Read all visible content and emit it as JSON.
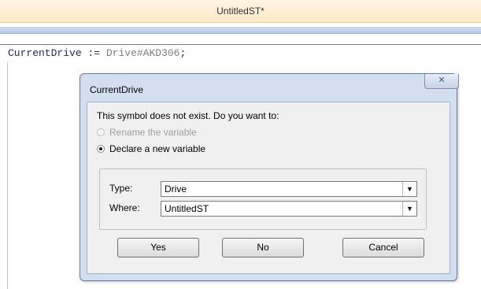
{
  "window": {
    "title": "UntitledST*"
  },
  "editor": {
    "code": {
      "identifier": "CurrentDrive",
      "operator": " := ",
      "value": "Drive#AKD306",
      "terminator": ";"
    }
  },
  "dialog": {
    "title": "CurrentDrive",
    "close_icon": "close-icon",
    "prompt": "This symbol does not exist. Do you want to:",
    "options": {
      "rename": {
        "label": "Rename the variable",
        "enabled": false,
        "selected": false
      },
      "declare": {
        "label": "Declare a new variable",
        "enabled": true,
        "selected": true
      }
    },
    "fields": {
      "type": {
        "label": "Type:",
        "value": "Drive"
      },
      "where": {
        "label": "Where:",
        "value": "UntitledST"
      }
    },
    "buttons": {
      "yes": "Yes",
      "no": "No",
      "cancel": "Cancel"
    }
  }
}
